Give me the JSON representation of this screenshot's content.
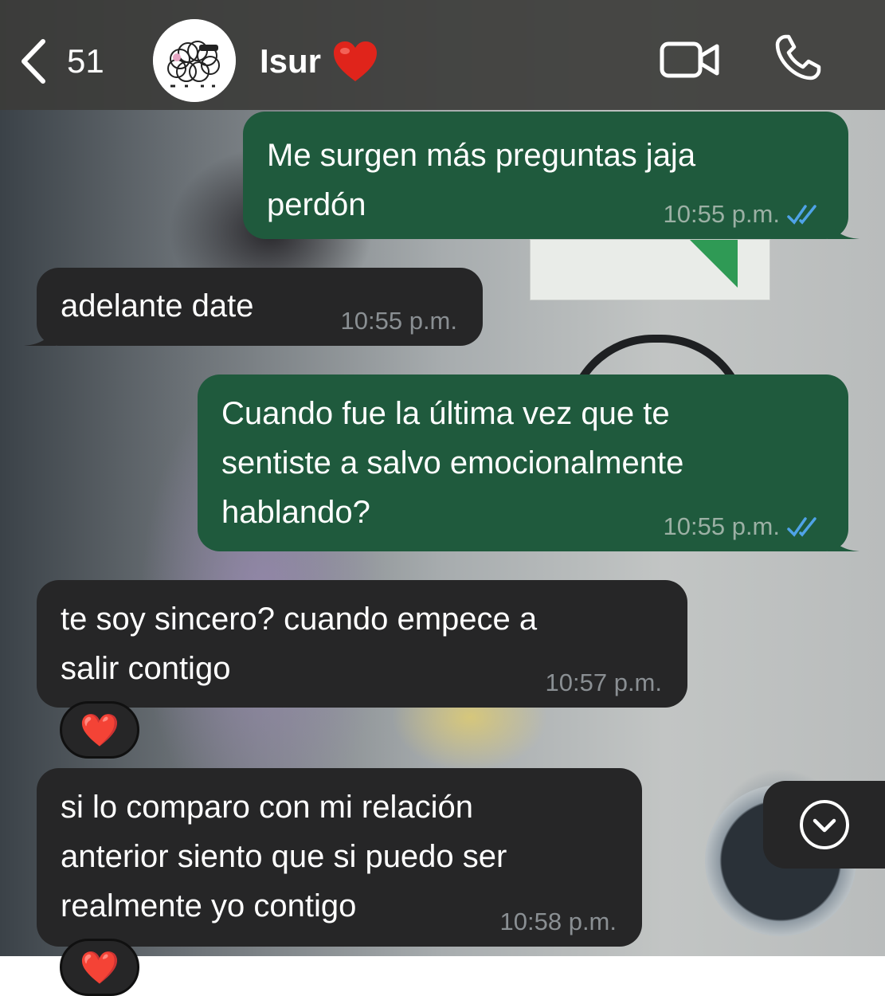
{
  "header": {
    "back_count": "51",
    "contact_name": "Isur",
    "contact_emoji": "❤️"
  },
  "messages": [
    {
      "direction": "out",
      "text": "Me surgen más preguntas jaja\nperdón",
      "time": "10:55 p.m.",
      "status": "read"
    },
    {
      "direction": "in",
      "text": "adelante date",
      "time": "10:55 p.m."
    },
    {
      "direction": "out",
      "text": "Cuando fue la última vez que te\nsentiste a salvo emocionalmente\nhablando?",
      "time": "10:55 p.m.",
      "status": "read"
    },
    {
      "direction": "in",
      "text": "te soy sincero? cuando empece a\nsalir contigo",
      "time": "10:57 p.m.",
      "reaction": "❤️"
    },
    {
      "direction": "in",
      "text": "si lo comparo con mi relación\nanterior siento que si puedo ser\nrealmente yo contigo",
      "time": "10:58 p.m.",
      "reaction": "❤️"
    }
  ],
  "colors": {
    "header_bg": "#3c3c3a",
    "outgoing_bubble": "#1f5a3d",
    "incoming_bubble": "#262627",
    "read_ticks": "#4fa3e8"
  },
  "icons": {
    "back": "chevron-left-icon",
    "video": "video-camera-icon",
    "call": "phone-icon",
    "scroll": "chevron-down-circle-icon"
  }
}
